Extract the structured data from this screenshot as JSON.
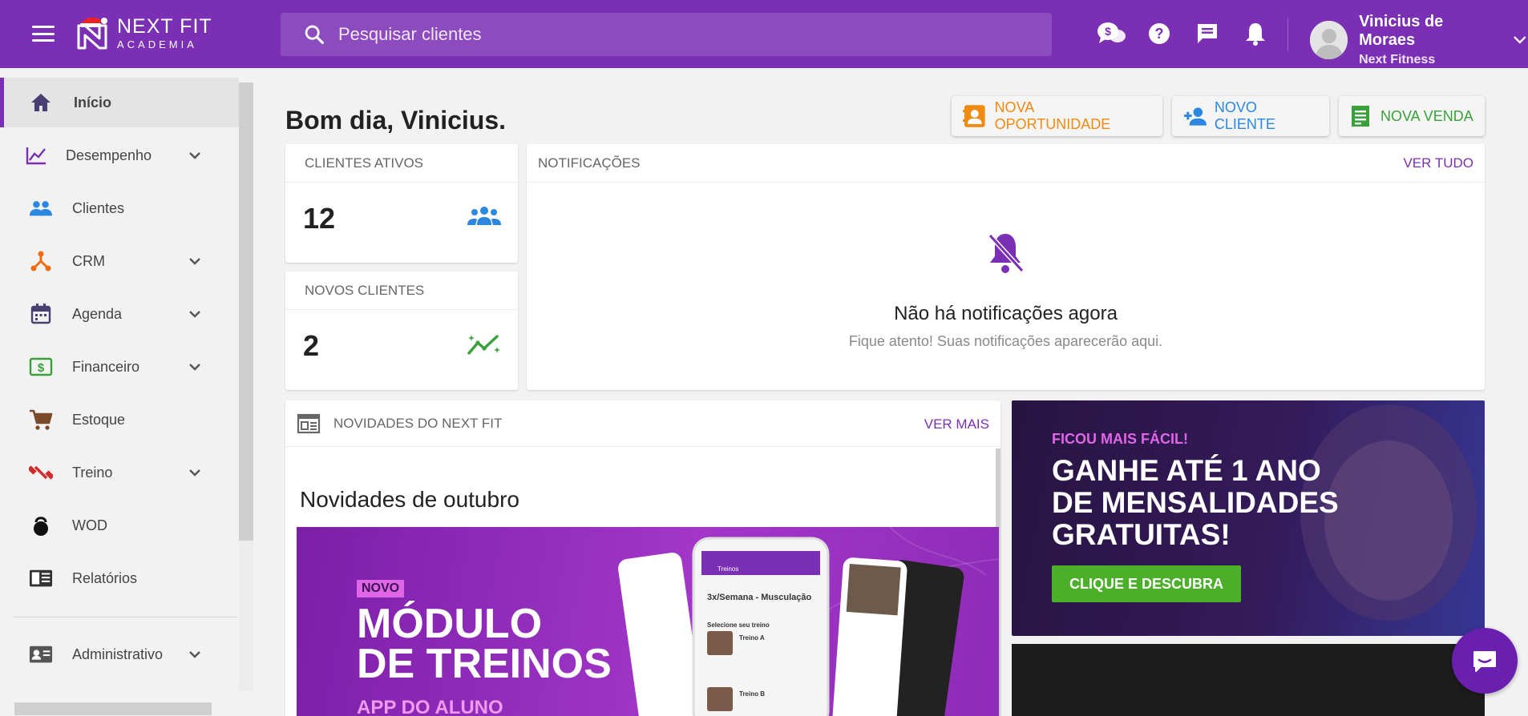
{
  "brand": {
    "name_line1": "NEXT FIT",
    "name_line2": "ACADEMIA"
  },
  "search": {
    "placeholder": "Pesquisar clientes"
  },
  "user": {
    "name": "Vinicius de Moraes",
    "org": "Next Fitness"
  },
  "topbar_icons": [
    "money-chat-icon",
    "help-icon",
    "chat-icon",
    "bell-icon"
  ],
  "sidebar": {
    "items": [
      {
        "label": "Início",
        "icon": "home-icon",
        "active": true,
        "expandable": false
      },
      {
        "label": "Desempenho",
        "icon": "chart-line-icon",
        "active": false,
        "expandable": true
      },
      {
        "label": "Clientes",
        "icon": "people-icon",
        "active": false,
        "expandable": false
      },
      {
        "label": "CRM",
        "icon": "crm-icon",
        "active": false,
        "expandable": true
      },
      {
        "label": "Agenda",
        "icon": "calendar-icon",
        "active": false,
        "expandable": true
      },
      {
        "label": "Financeiro",
        "icon": "money-icon",
        "active": false,
        "expandable": true
      },
      {
        "label": "Estoque",
        "icon": "cart-icon",
        "active": false,
        "expandable": false
      },
      {
        "label": "Treino",
        "icon": "dumbbell-icon",
        "active": false,
        "expandable": true
      },
      {
        "label": "WOD",
        "icon": "kettlebell-icon",
        "active": false,
        "expandable": false
      },
      {
        "label": "Relatórios",
        "icon": "reports-icon",
        "active": false,
        "expandable": false
      },
      {
        "label": "Administrativo",
        "icon": "id-card-icon",
        "active": false,
        "expandable": true
      }
    ]
  },
  "greeting": "Bom dia, Vinicius.",
  "actions": {
    "nova_oportunidade": "NOVA OPORTUNIDADE",
    "novo_cliente": "NOVO CLIENTE",
    "nova_venda": "NOVA VENDA"
  },
  "stats": {
    "clientes_ativos": {
      "title": "CLIENTES ATIVOS",
      "value": "12"
    },
    "novos_clientes": {
      "title": "NOVOS CLIENTES",
      "value": "2"
    }
  },
  "notifications": {
    "title": "NOTIFICAÇÕES",
    "link": "VER TUDO",
    "empty_title": "Não há notificações agora",
    "empty_sub": "Fique atento! Suas notificações aparecerão aqui."
  },
  "news": {
    "title": "NOVIDADES DO NEXT FIT",
    "link": "VER MAIS",
    "headline": "Novidades de outubro",
    "banner": {
      "badge": "NOVO",
      "line1": "MÓDULO",
      "line2": "DE TREINOS",
      "line3": "APP DO ALUNO",
      "phone_header": "Treinos",
      "phone_title": "3x/Semana - Musculação",
      "phone_section": "Selecione seu treino",
      "workout_a": "Treino A",
      "workout_b": "Treino B"
    }
  },
  "promo": {
    "kicker": "FICOU MAIS FÁCIL!",
    "line1": "GANHE ATÉ 1 ANO",
    "line2": "DE MENSALIDADES",
    "line3": "GRATUITAS!",
    "cta": "CLIQUE E DESCUBRA"
  },
  "colors": {
    "brand": "#7b2fb4",
    "orange": "#ef8a12",
    "blue": "#2b87e0",
    "green": "#3aa03a"
  }
}
